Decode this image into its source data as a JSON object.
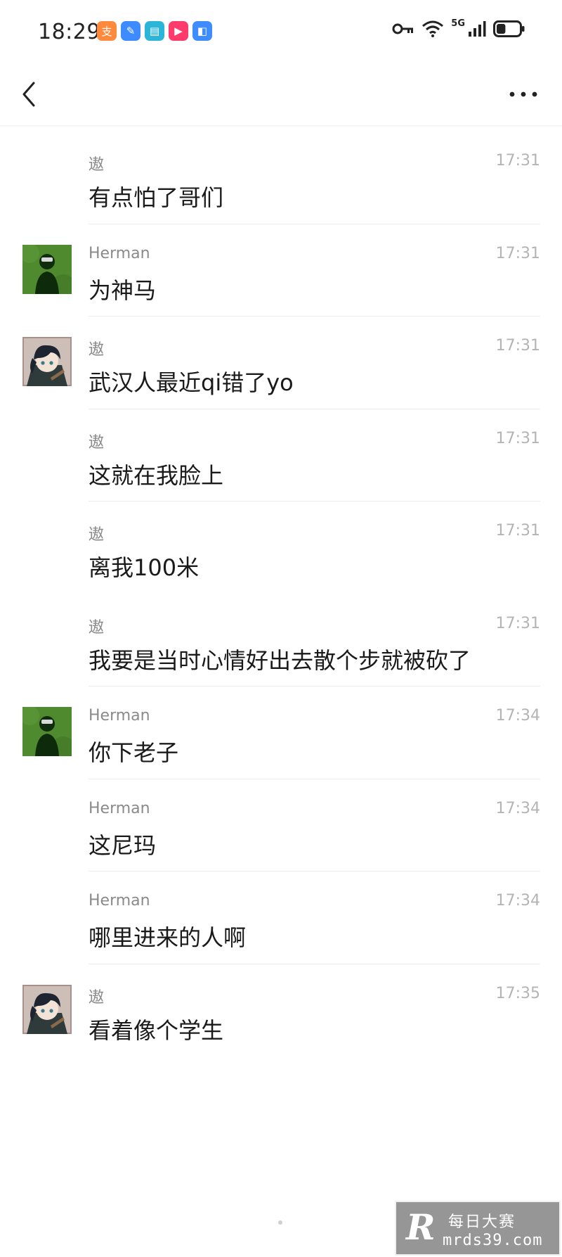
{
  "status_bar": {
    "time": "18:29",
    "network": "5G",
    "notification_icons": [
      {
        "icon": "alipay-app-icon",
        "color": "#ff8a3d",
        "glyph": "支"
      },
      {
        "icon": "notes-app-icon",
        "color": "#3d8bff",
        "glyph": "✎"
      },
      {
        "icon": "reader-app-icon",
        "color": "#2bb5d8",
        "glyph": "▤"
      },
      {
        "icon": "video-app-icon",
        "color": "#ff3b6b",
        "glyph": "▶"
      },
      {
        "icon": "wallet-app-icon",
        "color": "#3f8cff",
        "glyph": "◧"
      }
    ],
    "battery_level": 0.4
  },
  "nav": {
    "back_icon": "chevron-left-icon",
    "more_icon": "more-dots-icon"
  },
  "messages": [
    {
      "sender": "遨",
      "time": "17:31",
      "text": "有点怕了哥们",
      "avatar": "none",
      "divider": false
    },
    {
      "sender": "Herman",
      "time": "17:31",
      "text": "为神马",
      "avatar": "herman",
      "divider": true
    },
    {
      "sender": "遨",
      "time": "17:31",
      "text": "武汉人最近qi错了yo",
      "avatar": "anime",
      "divider": true
    },
    {
      "sender": "遨",
      "time": "17:31",
      "text": "这就在我脸上",
      "avatar": "none",
      "divider": true
    },
    {
      "sender": "遨",
      "time": "17:31",
      "text": "离我100米",
      "avatar": "none",
      "divider": true
    },
    {
      "sender": "遨",
      "time": "17:31",
      "text": "我要是当时心情好出去散个步就被砍了",
      "avatar": "none",
      "divider": false
    },
    {
      "sender": "Herman",
      "time": "17:34",
      "text": "你下老子",
      "avatar": "herman",
      "divider": true
    },
    {
      "sender": "Herman",
      "time": "17:34",
      "text": "这尼玛",
      "avatar": "none",
      "divider": true
    },
    {
      "sender": "Herman",
      "time": "17:34",
      "text": "哪里进来的人啊",
      "avatar": "none",
      "divider": true
    },
    {
      "sender": "遨",
      "time": "17:35",
      "text": "看着像个学生",
      "avatar": "anime",
      "divider": true
    }
  ],
  "watermark": {
    "logo": "R",
    "line1": "每日大赛",
    "line2": "mrds39.com"
  }
}
